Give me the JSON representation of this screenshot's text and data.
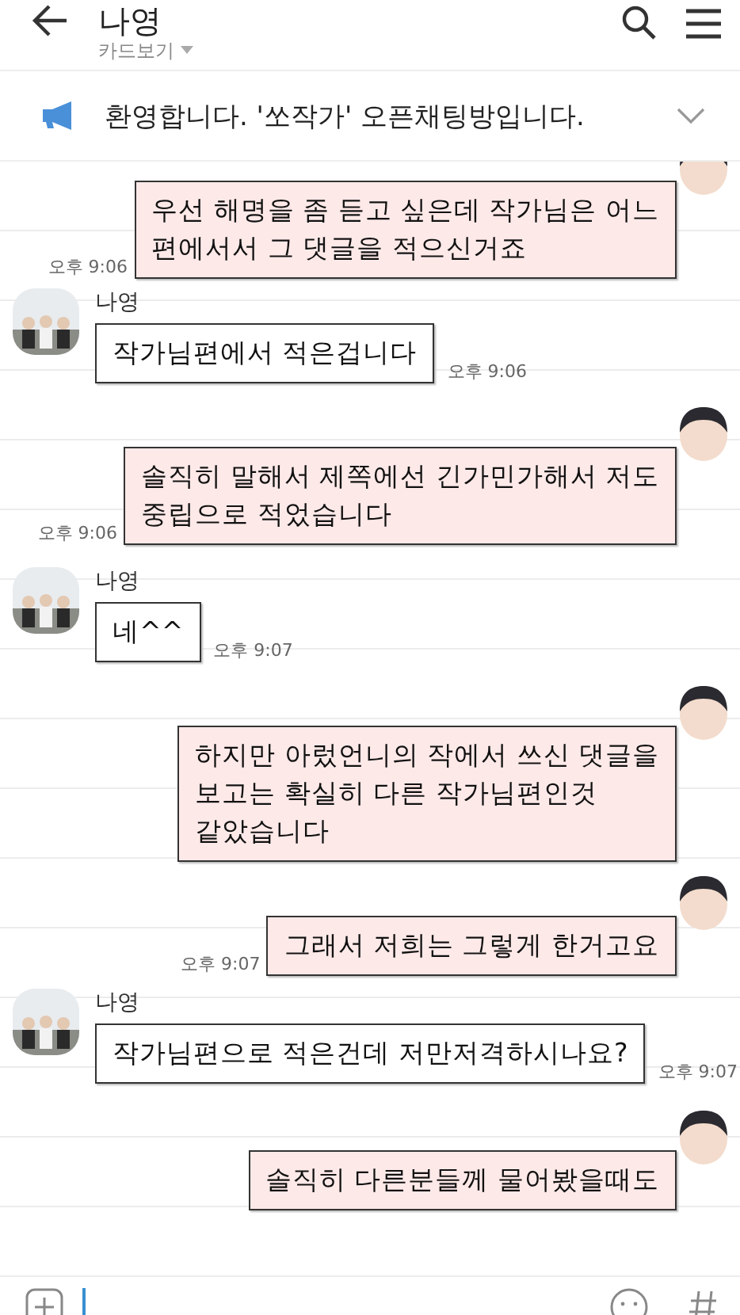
{
  "header": {
    "title": "나영",
    "subtitle": "카드보기"
  },
  "notice": {
    "text": "환영합니다. '쏘작가' 오픈채팅방입니다.",
    "expanded": false
  },
  "messages": [
    {
      "kind": "sent",
      "lines": [
        "우선 해명을 좀 듣고 싶은데 작가님은 어느",
        "편에서서 그 댓글을 적으신거죠"
      ],
      "time": "오후 9:06"
    },
    {
      "kind": "received",
      "sender": "나영",
      "lines": [
        "작가님편에서 적은겁니다"
      ],
      "time": "오후 9:06"
    },
    {
      "kind": "sent",
      "lines": [
        "솔직히 말해서 제쪽에선 긴가민가해서 저도",
        "중립으로 적었습니다"
      ],
      "time": "오후 9:06"
    },
    {
      "kind": "received",
      "sender": "나영",
      "lines": [
        "네^^"
      ],
      "time": "오후 9:07"
    },
    {
      "kind": "sent",
      "lines": [
        "하지만 아렀언니의 작에서 쓰신 댓글을",
        "보고는 확실히 다른 작가님편인것",
        "같았습니다"
      ]
    },
    {
      "kind": "sent",
      "lines": [
        "그래서 저희는 그렇게 한거고요"
      ],
      "time": "오후 9:07"
    },
    {
      "kind": "received",
      "sender": "나영",
      "lines": [
        "작가님편으로 적은건데 저만저격하시나요?"
      ],
      "time": "오후 9:07"
    },
    {
      "kind": "sent",
      "lines": [
        "솔직히 다른분들께 물어봤을때도"
      ]
    }
  ]
}
